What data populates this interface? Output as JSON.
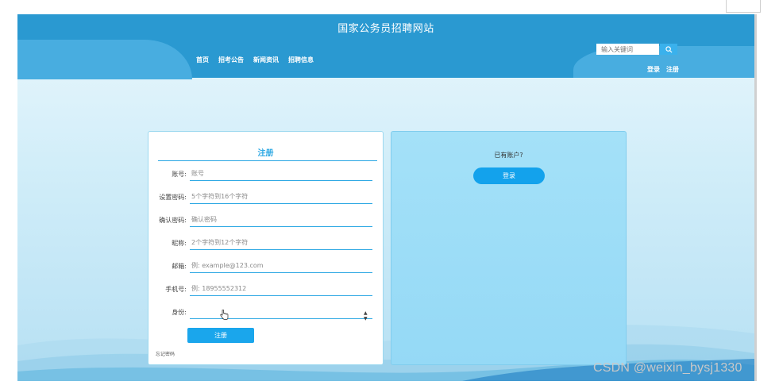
{
  "header": {
    "title": "国家公务员招聘网站",
    "nav": [
      "首页",
      "招考公告",
      "新闻资讯",
      "招聘信息"
    ],
    "search_placeholder": "输入关键词",
    "login_link": "登录",
    "register_link": "注册"
  },
  "register_form": {
    "title": "注册",
    "fields": [
      {
        "label": "账号:",
        "placeholder": "账号"
      },
      {
        "label": "设置密码:",
        "placeholder": "5个字符到16个字符"
      },
      {
        "label": "确认密码:",
        "placeholder": "确认密码"
      },
      {
        "label": "昵称:",
        "placeholder": "2个字符到12个字符"
      },
      {
        "label": "邮箱:",
        "placeholder": "例: example@123.com"
      },
      {
        "label": "手机号:",
        "placeholder": "例: 18955552312"
      },
      {
        "label": "身份:",
        "value": ""
      }
    ],
    "submit_label": "注册",
    "forgot_label": "忘记密码"
  },
  "login_side": {
    "prompt": "已有账户?",
    "button_label": "登录"
  },
  "watermark": "CSDN @weixin_bysj1330",
  "colors": {
    "header": "#2a99d1",
    "accent": "#2aa7e3",
    "button": "#1aa6ec"
  }
}
